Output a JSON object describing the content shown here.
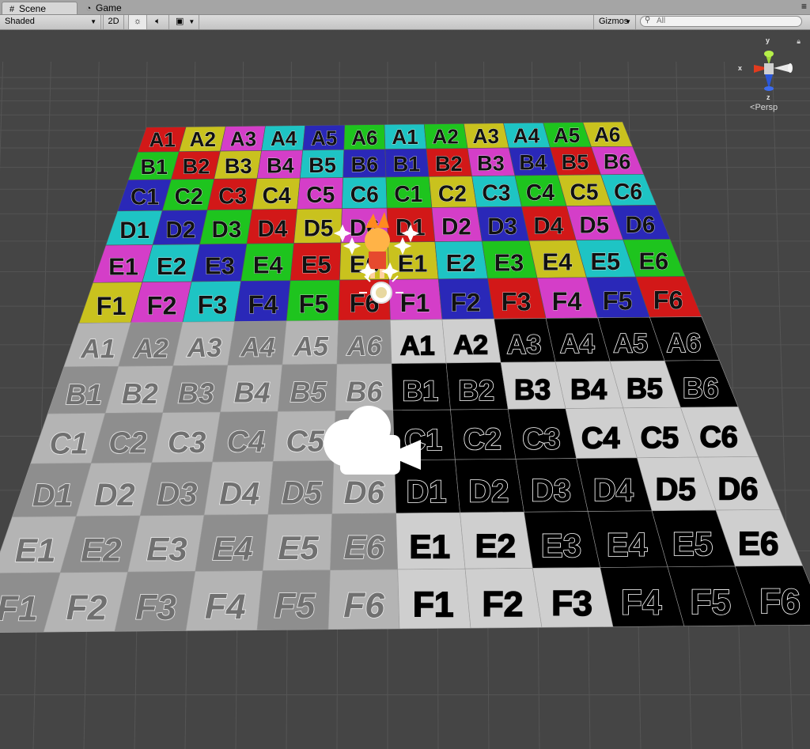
{
  "tabs": [
    {
      "label": "Scene",
      "icon": "grid-hash-icon"
    },
    {
      "label": "Game",
      "icon": "pacman-icon"
    }
  ],
  "toolbar": {
    "shading_mode": "Shaded",
    "mode_2d": "2D",
    "gizmos": "Gizmos",
    "search_placeholder": "All"
  },
  "gizmo": {
    "axis_y": "y",
    "axis_x": "x",
    "axis_z": "z",
    "projection": "Persp"
  },
  "grid": {
    "rows": [
      "A",
      "B",
      "C",
      "D",
      "E",
      "F"
    ],
    "cols": [
      "1",
      "2",
      "3",
      "4",
      "5",
      "6"
    ]
  },
  "colors": {
    "background": "#454545",
    "grey_quad_light": "#b4b4b4",
    "grey_quad_dark": "#8e8e8e",
    "black_quad": "#000000",
    "white_cell": "#cfcfcf",
    "palette": [
      "#d21818",
      "#c9c21e",
      "#d43ec8",
      "#1ec4c4",
      "#2a28b8",
      "#1ec41e"
    ]
  }
}
